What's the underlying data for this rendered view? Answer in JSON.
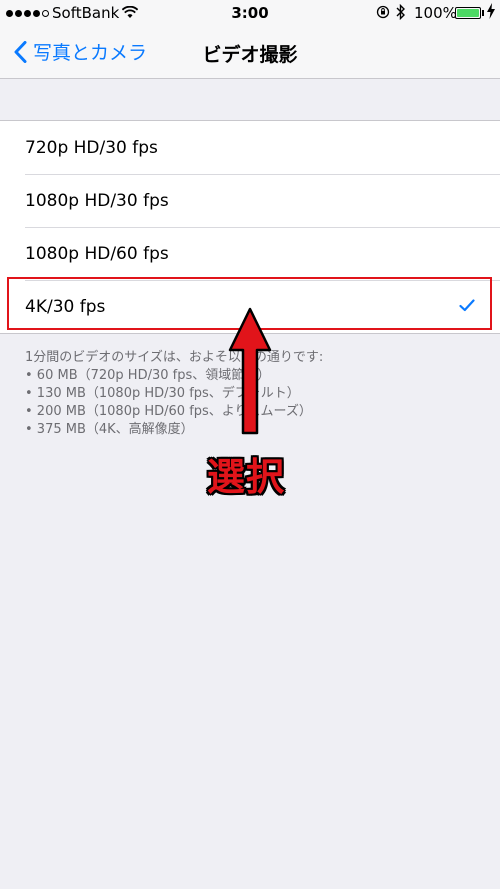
{
  "status_bar": {
    "carrier": "SoftBank",
    "time": "3:00",
    "battery_percent": "100%",
    "battery_level": 1.0,
    "battery_color": "#4cd964"
  },
  "nav": {
    "back_label": "写真とカメラ",
    "title": "ビデオ撮影"
  },
  "options": [
    {
      "label": "720p HD/30 fps",
      "selected": false
    },
    {
      "label": "1080p HD/30 fps",
      "selected": false
    },
    {
      "label": "1080p HD/60 fps",
      "selected": false
    },
    {
      "label": "4K/30 fps",
      "selected": true
    }
  ],
  "footer": {
    "intro": "1分間のビデオのサイズは、およそ以下の通りです:",
    "lines": [
      "• 60 MB（720p HD/30 fps、領域節約）",
      "• 130 MB（1080p HD/30 fps、デフォルト）",
      "• 200 MB（1080p HD/60 fps、よりスムーズ）",
      "• 375 MB（4K、高解像度）"
    ]
  },
  "annotation": {
    "label": "選択",
    "color": "#e1141a"
  },
  "colors": {
    "accent": "#0a7aff",
    "background": "#efeff4"
  }
}
